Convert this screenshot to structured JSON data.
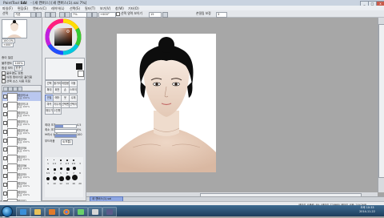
{
  "window": {
    "title_prefix": "PaintTool",
    "app_name": "SAI",
    "title": "- [새 캔버스] [새 캔버스(1).sai 7%]",
    "minimize": "_",
    "maximize": "□",
    "close": "x"
  },
  "menubar": {
    "items": [
      "파일(F)",
      "편집(E)",
      "캔버스(C)",
      "레이어(L)",
      "선택(S)",
      "필터(T)",
      "보기(V)",
      "창(W)",
      "기타(O)"
    ]
  },
  "toolbar": {
    "selection_label": "선택",
    "selection_mode": "기본",
    "zoom_value": "7%",
    "rotation_value": "+000°",
    "stabilizer_checkbox_label": "선택 영역 보이기",
    "stabilizer_value": "15",
    "shake_label": "손떨림 보정",
    "shake_value": "3"
  },
  "navigator": {
    "zoom_label": "100.0%",
    "angle_label": "+000°"
  },
  "left_panel": {
    "effect_header": "종이 질감",
    "opacity_label": "불투명도",
    "opacity_value": "100%",
    "blend_label": "합성 모드",
    "blend_value": "표준",
    "protect_label": "불투명도 보호",
    "clip_label": "아래 레이어로 클리핑",
    "ref_label": "선택 소스 사용 지정"
  },
  "layers": [
    {
      "name": "레이어14",
      "mode": "표준 100%"
    },
    {
      "name": "레이어13",
      "mode": "표준 100%"
    },
    {
      "name": "레이어12",
      "mode": "표준 100%"
    },
    {
      "name": "레이어11",
      "mode": "표준 100%"
    },
    {
      "name": "레이어10",
      "mode": "표준 100%"
    },
    {
      "name": "레이어9",
      "mode": "표준 100%"
    },
    {
      "name": "레이어8",
      "mode": "표준 100%"
    },
    {
      "name": "레이어7",
      "mode": "표준 100%"
    },
    {
      "name": "레이어6",
      "mode": "표준 100%"
    },
    {
      "name": "레이어5",
      "mode": "표준 100%"
    },
    {
      "name": "레이어4",
      "mode": "표준 100%"
    },
    {
      "name": "레이어3",
      "mode": "표준 100%"
    },
    {
      "name": "레이어2",
      "mode": "표준 100%"
    },
    {
      "name": "레이어1",
      "mode": "표준 100%"
    }
  ],
  "tools": {
    "labels": [
      "선택",
      "올가미",
      "마법봉",
      "이동",
      "확대",
      "회전",
      "손",
      "스포이드",
      "연필",
      "에어",
      "붓",
      "수채",
      "마커",
      "지우개",
      "선택펜",
      "선택지우",
      "채우기",
      "2진펜"
    ],
    "size_label": "최대 크기",
    "size_value": "4.5",
    "minsize_label": "최소 크기",
    "minsize_value": "0%",
    "density_label": "브러시 농도",
    "density_value": "100",
    "quality_label": "부드러움",
    "quality_value": "4(보통)",
    "brush_sizes": [
      "1",
      "1.5",
      "2",
      "2.3",
      "2.6",
      "3",
      "3.5",
      "4",
      "5",
      "6",
      "7",
      "8",
      "9",
      "10",
      "12",
      "14",
      "16",
      "20"
    ]
  },
  "doc_tab": {
    "label": "새 캔버스(1).sai"
  },
  "statusbar": {
    "text": "메모리 사용량: 8% (메모리 728MB) 메모리 사용: 2042MB"
  },
  "clock": {
    "time": "오후 10:33",
    "date": "2014-11-22"
  },
  "colors": {
    "selected_layer": "#b9c7ef",
    "accent": "#5f79c1"
  }
}
